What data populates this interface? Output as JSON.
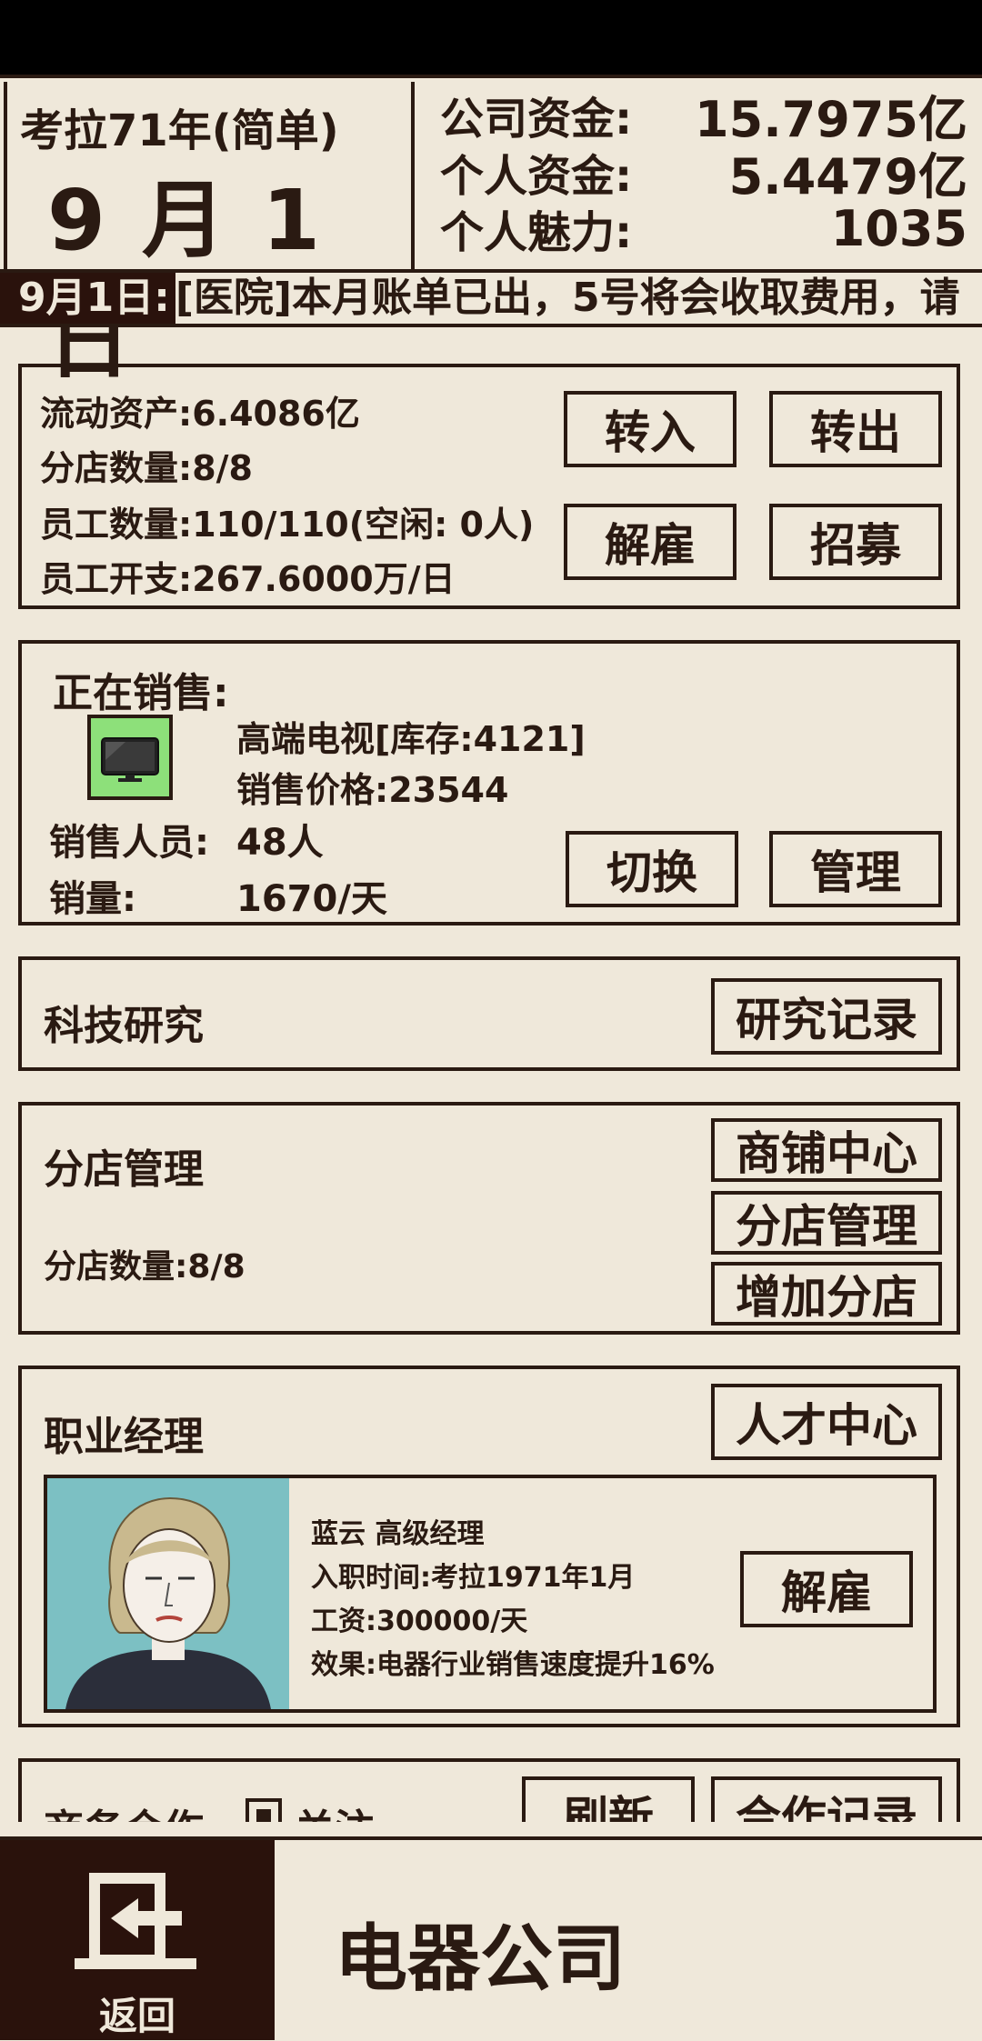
{
  "header": {
    "year": "考拉71年(简单)",
    "date": "9 月 1 日",
    "company_funds_label": "公司资金:",
    "company_funds_value": "15.7975亿",
    "personal_funds_label": "个人资金:",
    "personal_funds_value": "5.4479亿",
    "charisma_label": "个人魅力:",
    "charisma_value": "1035"
  },
  "ticker": {
    "date": "9月1日:",
    "message": "[医院]本月账单已出，5号将会收取费用，请"
  },
  "assets": {
    "liquid": "流动资产:6.4086亿",
    "branches": "分店数量:8/8",
    "staff": "员工数量:110/110(空闲: 0人)",
    "expense": "员工开支:267.6000万/日",
    "btn_in": "转入",
    "btn_out": "转出",
    "btn_fire": "解雇",
    "btn_recruit": "招募"
  },
  "sales": {
    "title": "正在销售:",
    "product_icon": "tv-icon",
    "product": "高端电视[库存:4121]",
    "price": "销售价格:23544",
    "staff_label": "销售人员:",
    "staff_value": "48人",
    "volume_label": "销量:",
    "volume_value": "1670/天",
    "btn_switch": "切换",
    "btn_manage": "管理"
  },
  "research": {
    "title": "科技研究",
    "btn_records": "研究记录"
  },
  "branch_mgmt": {
    "title": "分店管理",
    "count": "分店数量:8/8",
    "btn_shop_center": "商铺中心",
    "btn_branch_manage": "分店管理",
    "btn_add_branch": "增加分店"
  },
  "manager": {
    "title": "职业经理",
    "btn_talent": "人才中心",
    "name": "蓝云 高级经理",
    "joined": "入职时间:考拉1971年1月",
    "salary": "工资:300000/天",
    "effect": "效果:电器行业销售速度提升16%",
    "btn_fire": "解雇"
  },
  "business": {
    "title": "商务合作",
    "follow_label": "关注",
    "btn_refresh": "刷新",
    "btn_records": "合作记录"
  },
  "footer": {
    "back_label": "返回",
    "company_name": "电器公司"
  },
  "colors": {
    "background": "#efe8da",
    "ink": "#2a1a12",
    "footer_dark": "#2a120c",
    "icon_green": "#8de07a",
    "portrait_bg": "#7cc0c3"
  }
}
